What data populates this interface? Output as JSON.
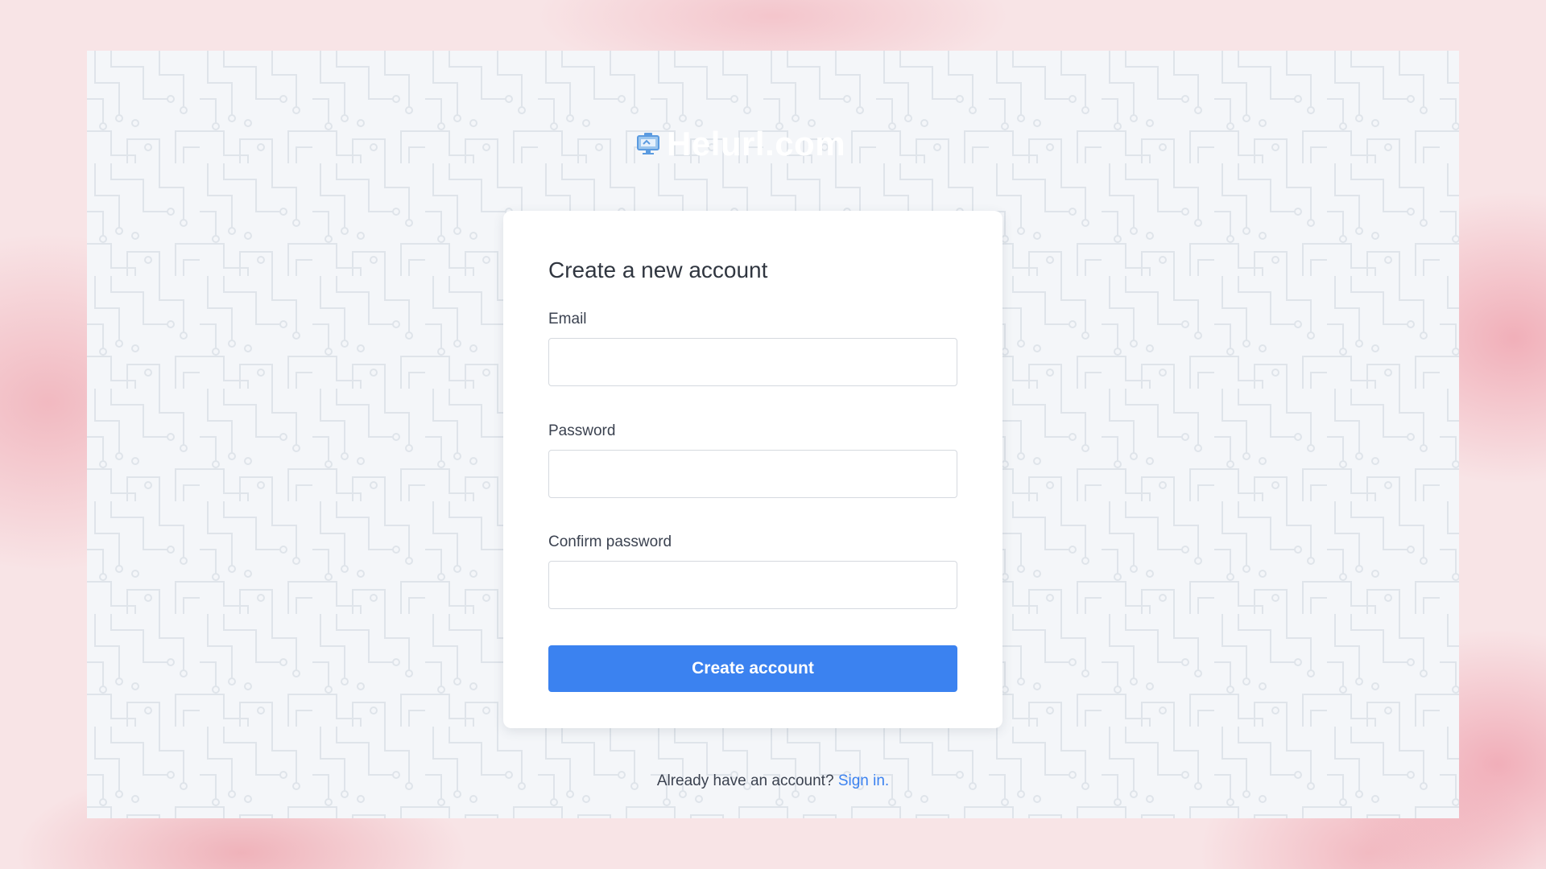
{
  "brand": {
    "name": "Helurl.com",
    "icon": "monitor-logo-icon"
  },
  "form": {
    "title": "Create a new account",
    "email_label": "Email",
    "email_value": "",
    "password_label": "Password",
    "password_value": "",
    "confirm_label": "Confirm password",
    "confirm_value": "",
    "submit_label": "Create account"
  },
  "footer": {
    "prompt": "Already have an account?",
    "link_label": "Sign in."
  },
  "colors": {
    "accent": "#3b82f0",
    "panel_background": "#f4f6f9",
    "outer_background": "#f8e4e6"
  }
}
